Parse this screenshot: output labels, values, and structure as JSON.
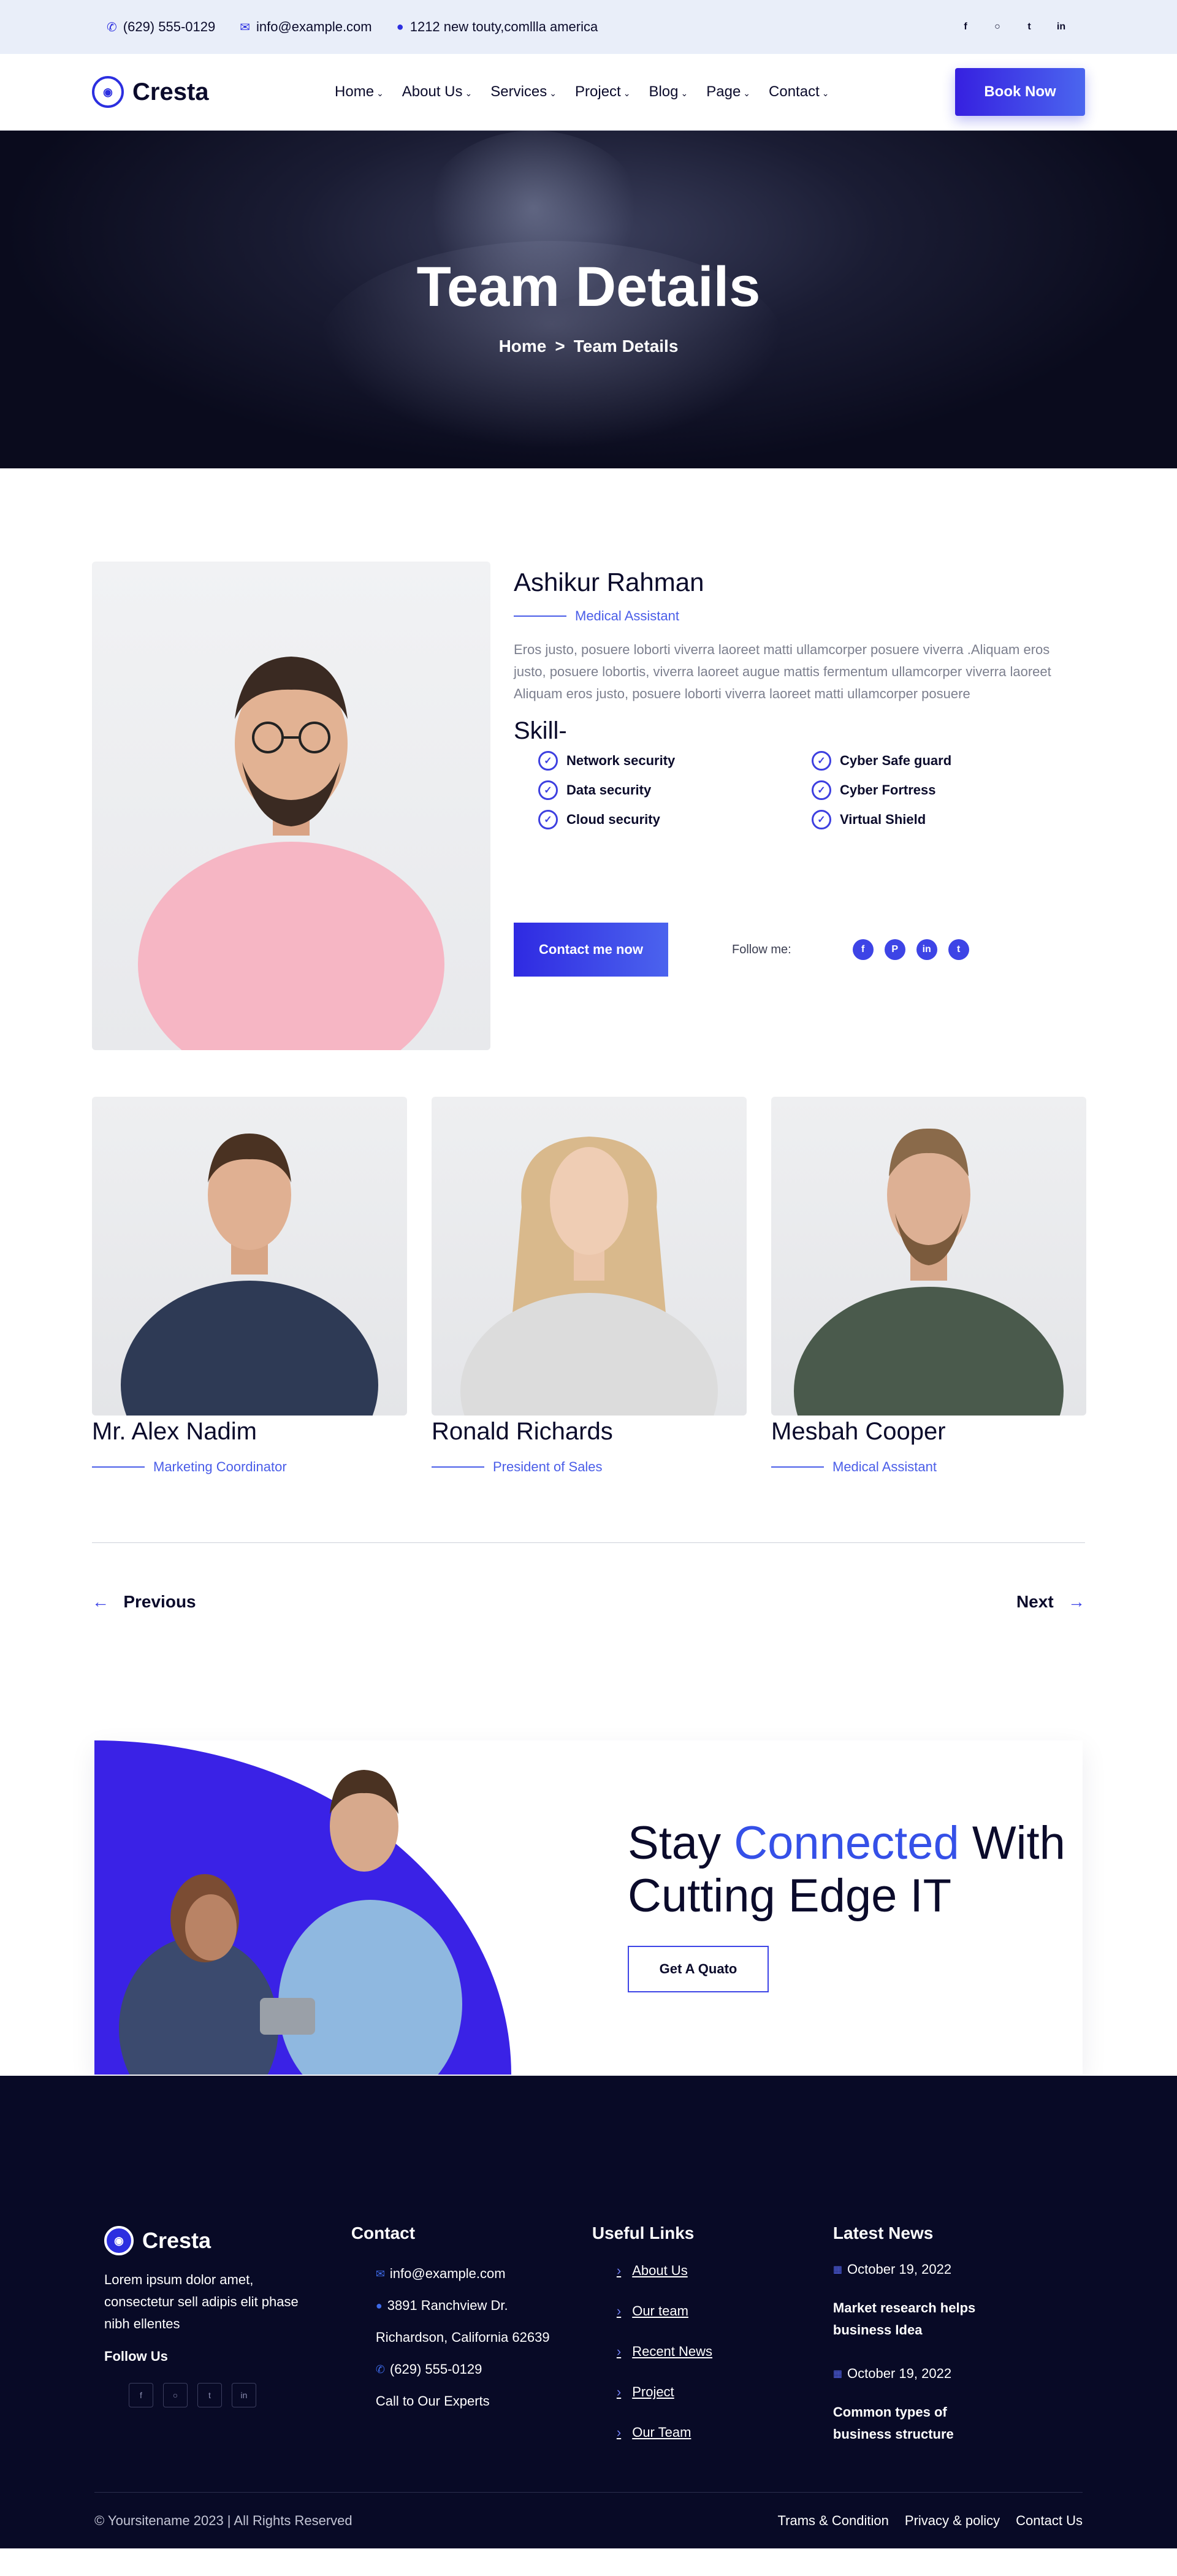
{
  "topbar": {
    "phone": "(629) 555-0129",
    "email": "info@example.com",
    "address": "1212 new touty,comllla america",
    "socials": [
      "facebook-icon",
      "instagram-icon",
      "twitter-icon",
      "linkedin-icon"
    ]
  },
  "header": {
    "logo_text": "Cresta",
    "nav": [
      "Home",
      "About Us",
      "Services",
      "Project",
      "Blog",
      "Page",
      "Contact"
    ],
    "book_label": "Book Now"
  },
  "hero": {
    "title": "Team Details",
    "crumb_home": "Home",
    "crumb_sep": ">",
    "crumb_current": "Team Details"
  },
  "profile": {
    "name": "Ashikur Rahman",
    "role": "Medical Assistant",
    "description": "Eros justo, posuere loborti viverra laoreet matti ullamcorper posuere viverra .Aliquam eros justo, posuere lobortis, viverra laoreet augue mattis fermentum ullamcorper viverra laoreet Aliquam eros justo, posuere loborti viverra laoreet matti ullamcorper posuere",
    "skill_title": "Skill-",
    "skills": [
      "Network security",
      "Cyber Safe guard",
      "Data security",
      "Cyber Fortress",
      "Cloud security",
      "Virtual Shield"
    ],
    "contact_label": "Contact me now",
    "follow_label": "Follow me:"
  },
  "team": [
    {
      "name": "Mr. Alex Nadim",
      "role": "Marketing Coordinator"
    },
    {
      "name": "Ronald Richards",
      "role": "President of Sales"
    },
    {
      "name": "Mesbah Cooper",
      "role": "Medical Assistant"
    }
  ],
  "pager": {
    "previous": "Previous",
    "next": "Next"
  },
  "cta": {
    "line1_a": "Stay ",
    "line1_accent": "Connected",
    "line1_b": " With",
    "line2": "Cutting Edge IT",
    "button": "Get A Quato"
  },
  "footer": {
    "logo_text": "Cresta",
    "about": "Lorem ipsum dolor amet, consectetur sell adipis elit phase nibh ellentes",
    "follow_us": "Follow Us",
    "contact_title": "Contact",
    "contact_email": "info@example.com",
    "contact_address1": "3891 Ranchview Dr.",
    "contact_address2": "Richardson, California 62639",
    "contact_phone": "(629) 555-0129",
    "contact_cta": "Call to Our Experts",
    "links_title": "Useful Links",
    "links": [
      "About Us",
      "Our team",
      "Recent News",
      "Project",
      "Our Team"
    ],
    "news_title": "Latest News",
    "news": [
      {
        "date": "October 19, 2022",
        "title": "Market research helps business Idea"
      },
      {
        "date": "October 19, 2022",
        "title": "Common types of business structure"
      }
    ],
    "copyright": "© Yoursitename 2023 | All Rights Reserved",
    "legal": [
      "Trams & Condition",
      "Privacy & policy",
      "Contact Us"
    ]
  },
  "colors": {
    "accent": "#3d44e6",
    "footer_bg": "#080a26",
    "topbar_bg": "#e9eef9"
  }
}
